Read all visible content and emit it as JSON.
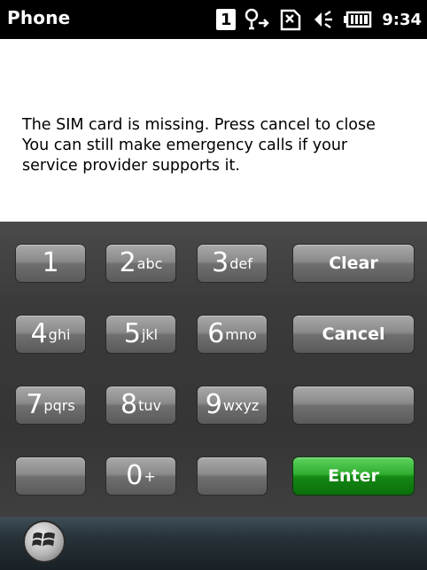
{
  "status_bar": {
    "app_title": "Phone",
    "line_badge": "1",
    "clock": "9:34",
    "icons": [
      "line-1-icon",
      "no-signal-icon",
      "no-sim-icon",
      "speaker-icon",
      "battery-icon"
    ]
  },
  "message": {
    "line1": "The SIM card is missing. Press cancel to close",
    "line2": "You can still make emergency calls if your",
    "line3": "service provider supports it."
  },
  "keypad": {
    "keys": [
      {
        "digit": "1",
        "letters": ""
      },
      {
        "digit": "2",
        "letters": "abc"
      },
      {
        "digit": "3",
        "letters": "def"
      },
      {
        "digit": "4",
        "letters": "ghi"
      },
      {
        "digit": "5",
        "letters": "jkl"
      },
      {
        "digit": "6",
        "letters": "mno"
      },
      {
        "digit": "7",
        "letters": "pqrs"
      },
      {
        "digit": "8",
        "letters": "tuv"
      },
      {
        "digit": "9",
        "letters": "wxyz"
      },
      {
        "digit": "0",
        "letters": "+"
      }
    ],
    "clear_label": "Clear",
    "cancel_label": "Cancel",
    "enter_label": "Enter"
  },
  "colors": {
    "enter_button": "#2fae2f",
    "key": "#8a8a8a",
    "status_bar": "#000000"
  }
}
